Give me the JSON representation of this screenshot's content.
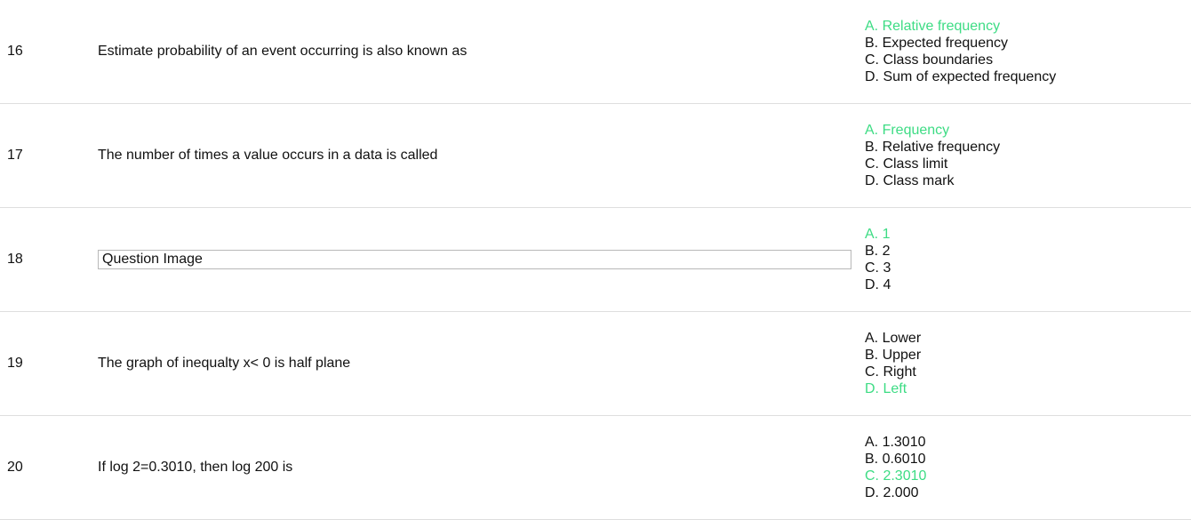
{
  "questions": [
    {
      "number": "16",
      "text": "Estimate probability of an event occurring is also known as",
      "is_image": false,
      "options": [
        {
          "label": "A. Relative frequency",
          "correct": true
        },
        {
          "label": "B. Expected frequency",
          "correct": false
        },
        {
          "label": "C. Class boundaries",
          "correct": false
        },
        {
          "label": "D. Sum of expected frequency",
          "correct": false
        }
      ]
    },
    {
      "number": "17",
      "text": "The number of times a value occurs in a data is called",
      "is_image": false,
      "options": [
        {
          "label": "A. Frequency",
          "correct": true
        },
        {
          "label": "B. Relative frequency",
          "correct": false
        },
        {
          "label": "C. Class limit",
          "correct": false
        },
        {
          "label": "D. Class mark",
          "correct": false
        }
      ]
    },
    {
      "number": "18",
      "text": "Question Image",
      "is_image": true,
      "options": [
        {
          "label": "A. 1",
          "correct": true
        },
        {
          "label": "B. 2",
          "correct": false
        },
        {
          "label": "C. 3",
          "correct": false
        },
        {
          "label": "D. 4",
          "correct": false
        }
      ]
    },
    {
      "number": "19",
      "text": "The graph of inequalty x< 0 is half plane",
      "is_image": false,
      "options": [
        {
          "label": "A. Lower",
          "correct": false
        },
        {
          "label": "B. Upper",
          "correct": false
        },
        {
          "label": "C. Right",
          "correct": false
        },
        {
          "label": "D. Left",
          "correct": true
        }
      ]
    },
    {
      "number": "20",
      "text": "If log 2=0.3010, then log 200 is",
      "is_image": false,
      "options": [
        {
          "label": "A. 1.3010",
          "correct": false
        },
        {
          "label": "B. 0.6010",
          "correct": false
        },
        {
          "label": "C. 2.3010",
          "correct": true
        },
        {
          "label": "D. 2.000",
          "correct": false
        }
      ]
    }
  ],
  "colors": {
    "correct_answer": "#3ddc84",
    "text": "#111111",
    "divider": "#dedede"
  }
}
